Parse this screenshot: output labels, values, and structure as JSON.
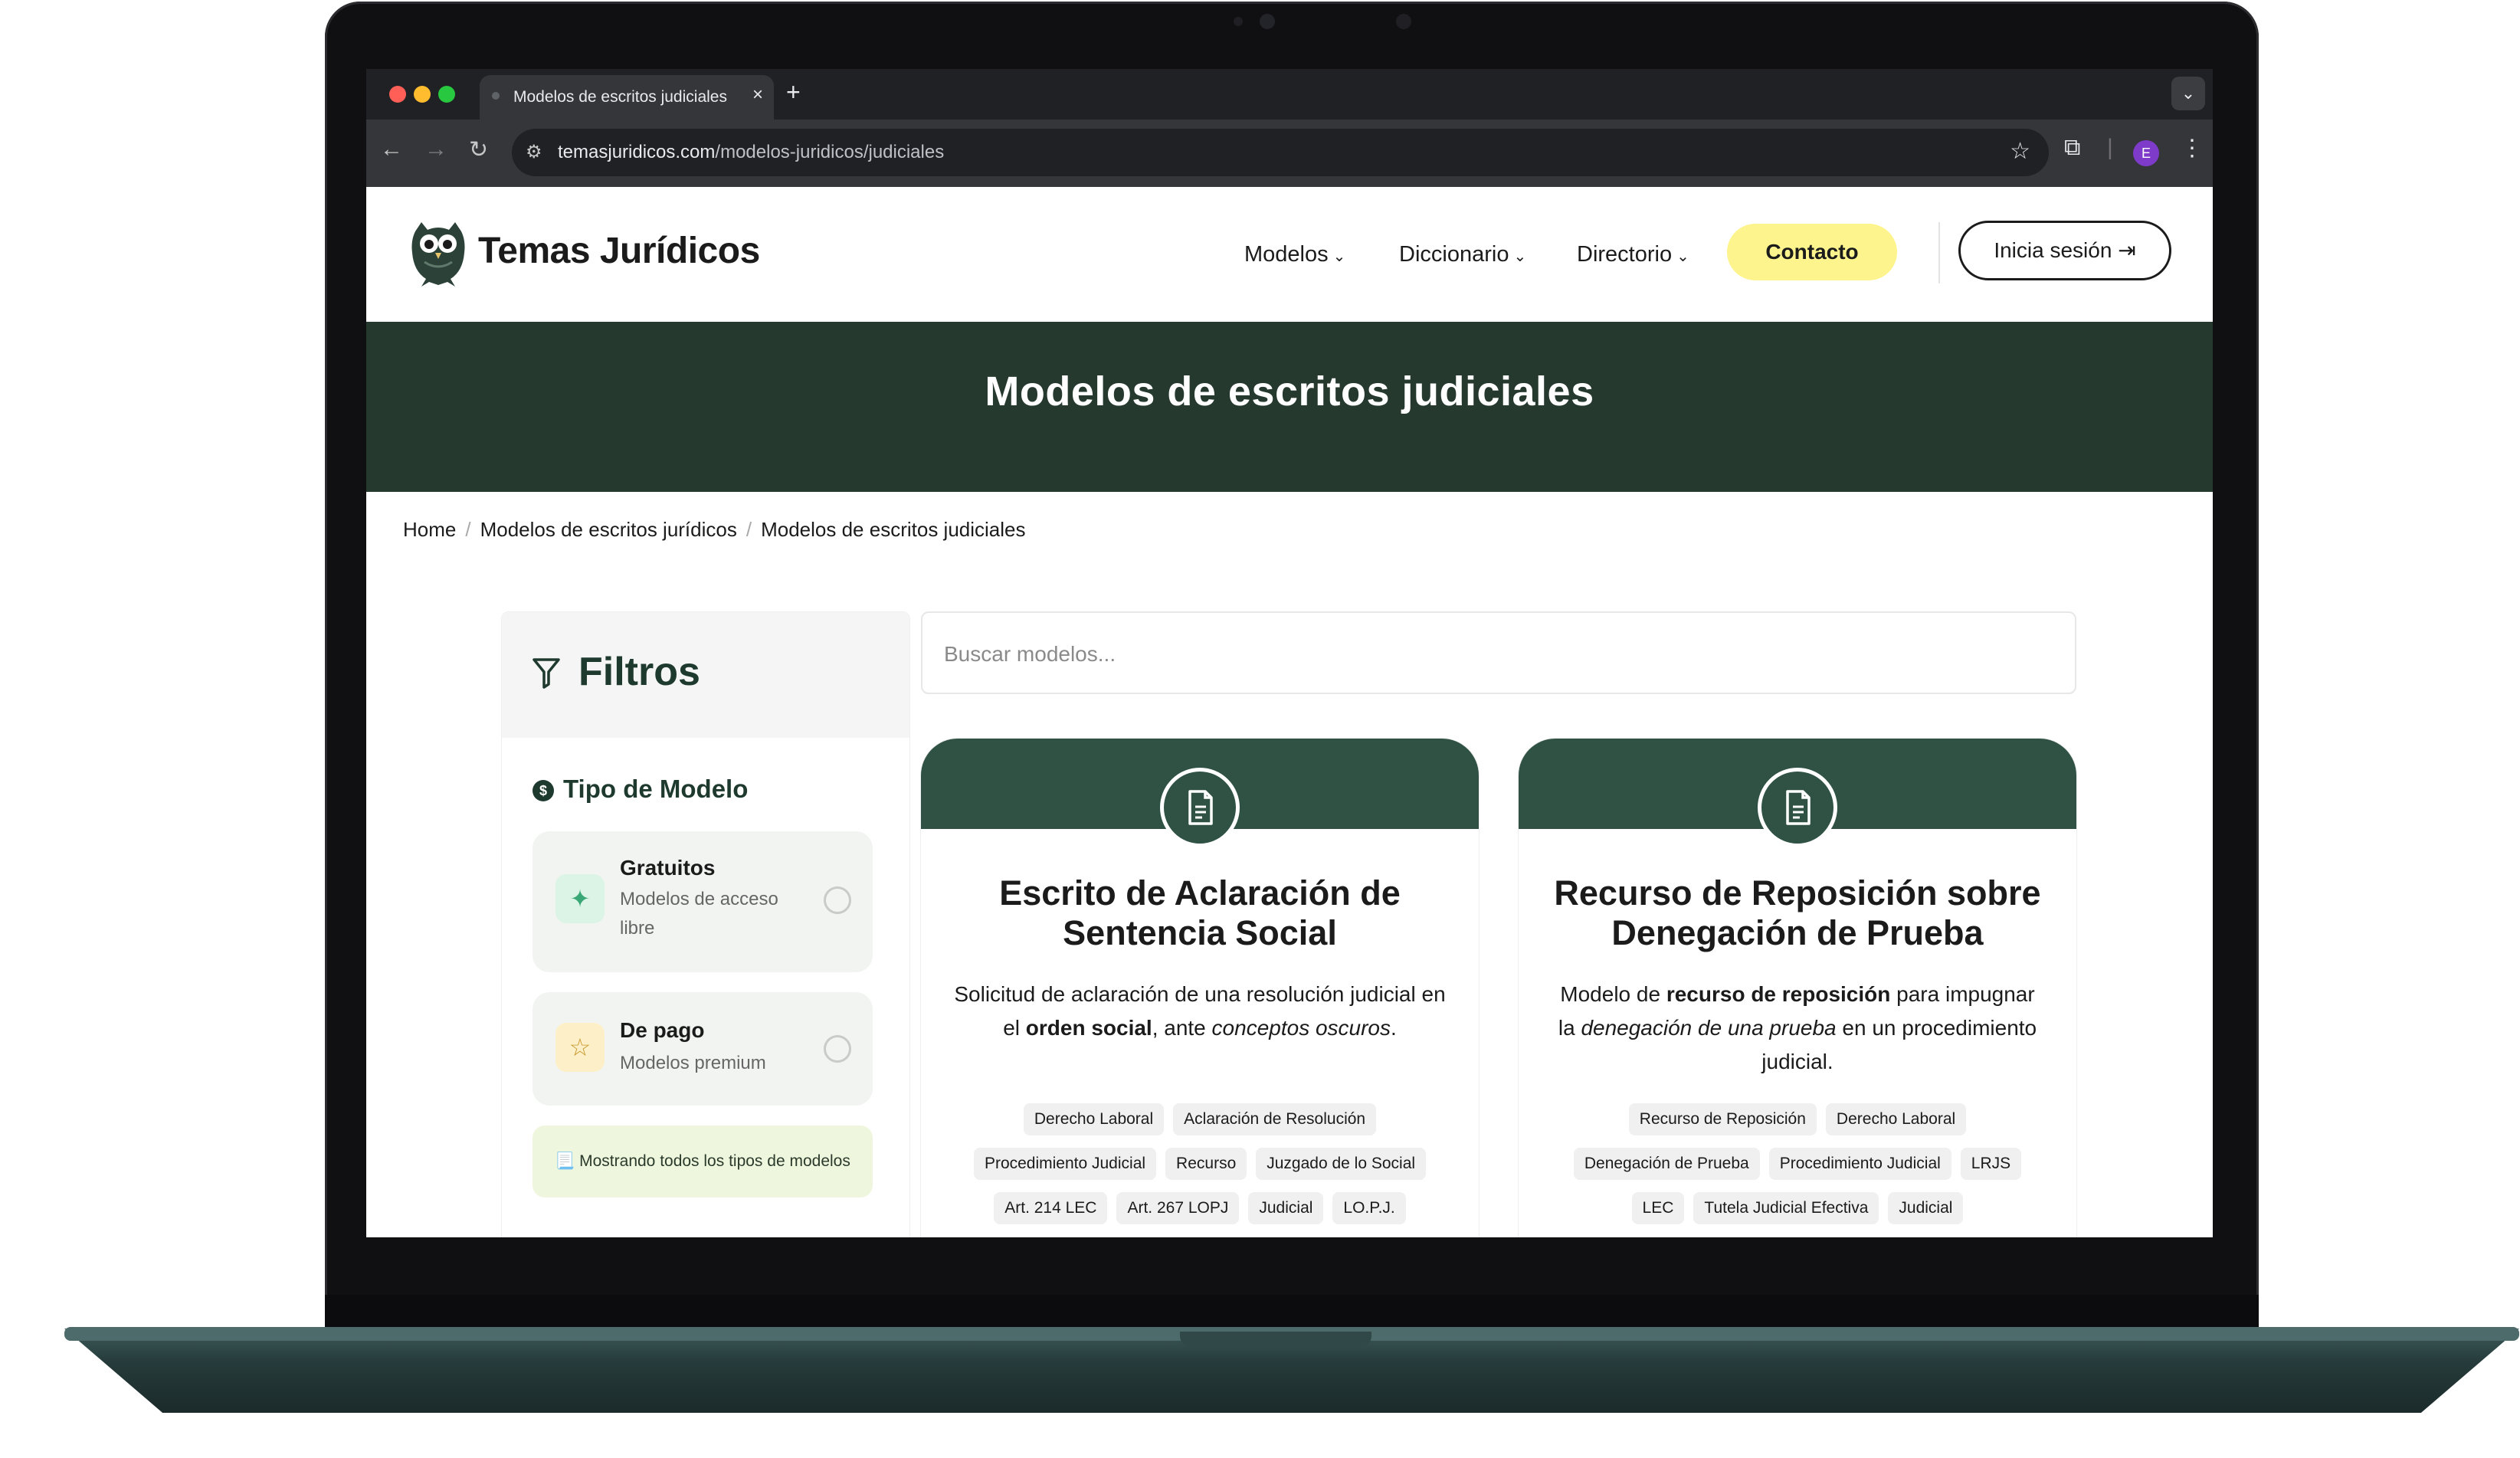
{
  "browser": {
    "tab_title": "Modelos de escritos judiciales",
    "new_tab": "+",
    "close": "×",
    "url_domain": "temasjuridicos.com",
    "url_path": "/modelos-juridicos/judiciales",
    "profile_initial": "E",
    "colors": {
      "close": "#ff5f57",
      "minimize": "#febc2e",
      "maximize": "#28c840"
    }
  },
  "header": {
    "logo_text": "Temas Jurídicos",
    "nav": [
      {
        "label": "Modelos"
      },
      {
        "label": "Diccionario"
      },
      {
        "label": "Directorio"
      }
    ],
    "contact_label": "Contacto",
    "login_label": "Inicia sesión"
  },
  "hero": {
    "title": "Modelos de escritos judiciales"
  },
  "breadcrumb": [
    "Home",
    "Modelos de escritos jurídicos",
    "Modelos de escritos judiciales"
  ],
  "filters": {
    "title": "Filtros",
    "section_title": "Tipo de Modelo",
    "options": [
      {
        "title": "Gratuitos",
        "subtitle": "Modelos de acceso libre",
        "icon": "sparkles-icon"
      },
      {
        "title": "De pago",
        "subtitle": "Modelos premium",
        "icon": "star-icon"
      }
    ],
    "note": "📃 Mostrando todos los tipos de modelos"
  },
  "search": {
    "placeholder": "Buscar modelos..."
  },
  "cards": [
    {
      "title": "Escrito de Aclaración de Sentencia Social",
      "desc_parts": [
        "Solicitud de aclaración de una resolución judicial en el ",
        "orden social",
        ", ante ",
        "conceptos oscuros",
        "."
      ],
      "tags": [
        "Derecho Laboral",
        "Aclaración de Resolución",
        "Procedimiento Judicial",
        "Recurso",
        "Juzgado de lo Social",
        "Art. 214 LEC",
        "Art. 267 LOPJ",
        "Judicial",
        "LO.P.J."
      ]
    },
    {
      "title": "Recurso de Reposición sobre Denegación de Prueba",
      "desc_parts": [
        "Modelo de ",
        "recurso de reposición",
        " para impugnar la ",
        "denegación de una prueba",
        " en un procedimiento judicial."
      ],
      "tags": [
        "Recurso de Reposición",
        "Derecho Laboral",
        "Denegación de Prueba",
        "Procedimiento Judicial",
        "LRJS",
        "LEC",
        "Tutela Judicial Efectiva",
        "Judicial"
      ]
    }
  ],
  "colors": {
    "brand_dark": "#26392f",
    "card_band": "#2f5245",
    "contact_yellow": "#fdf48d"
  }
}
